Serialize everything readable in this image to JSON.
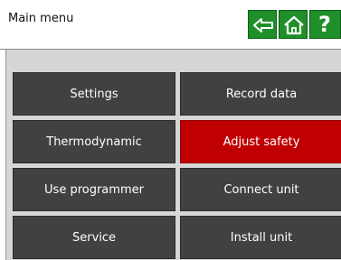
{
  "header": {
    "title": "Main menu",
    "buttons": {
      "back_icon": "back-arrow-icon",
      "home_icon": "home-icon",
      "help_label": "?"
    },
    "button_color": "#1f8f2a"
  },
  "menu": {
    "items": [
      {
        "label": "Settings",
        "active": false
      },
      {
        "label": "Record data",
        "active": false
      },
      {
        "label": "Thermodynamic",
        "active": false
      },
      {
        "label": "Adjust safety",
        "active": true
      },
      {
        "label": "Use programmer",
        "active": false
      },
      {
        "label": "Connect unit",
        "active": false
      },
      {
        "label": "Service",
        "active": false
      },
      {
        "label": "Install unit",
        "active": false
      }
    ],
    "button_color": "#414141",
    "active_color": "#c00000"
  }
}
